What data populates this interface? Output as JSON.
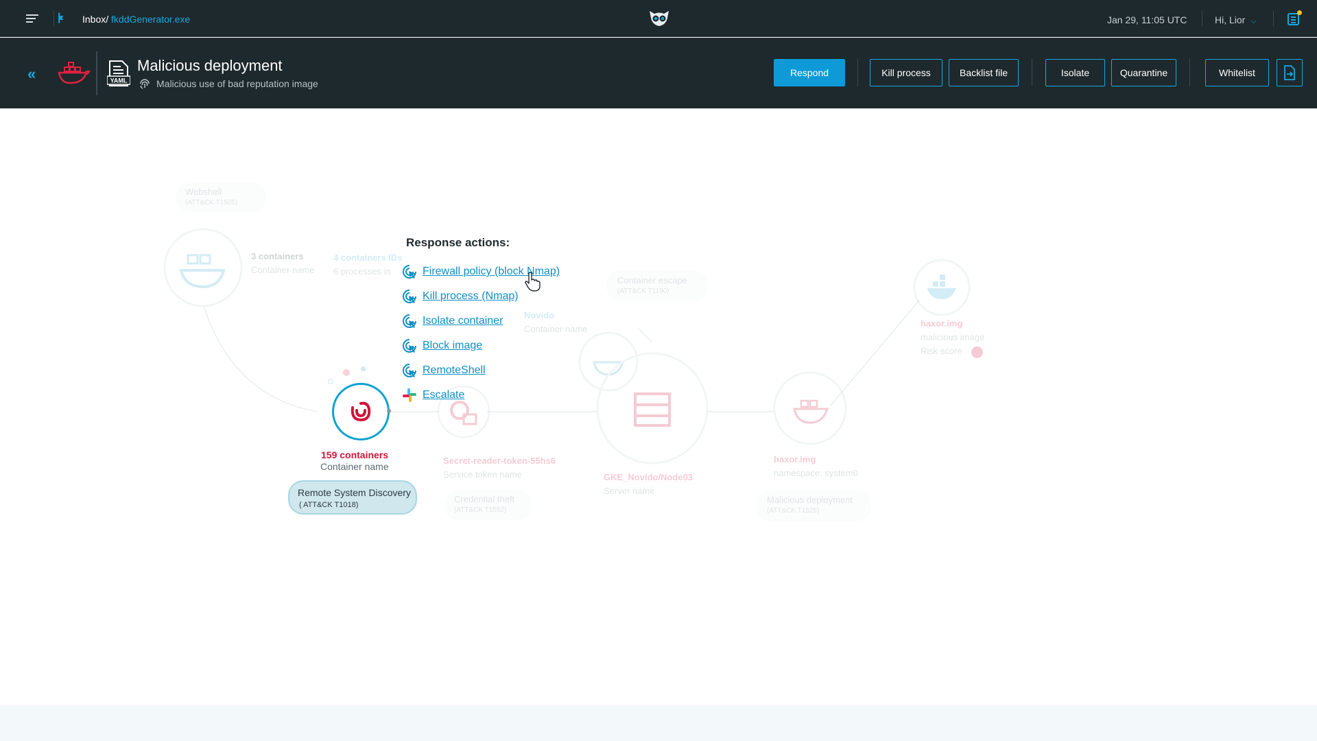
{
  "topbar": {
    "breadcrumb_root": "Inbox/",
    "breadcrumb_current": "fkddGenerator.exe",
    "datetime": "Jan 29, 11:05 UTC",
    "user_greeting": "Hi, Lior"
  },
  "header": {
    "yaml_label": "YAML",
    "title": "Malicious deployment",
    "subtitle": "Malicious use of bad reputation image",
    "buttons": {
      "respond": "Respond",
      "kill_process": "Kill  process",
      "blacklist_file": "Backlist file",
      "isolate": "Isolate",
      "quarantine": "Quarantine",
      "whitelist": "Whitelist"
    }
  },
  "graph": {
    "main_node": {
      "count": "159 containers",
      "name": "Container name",
      "technique": "Remote System Discovery",
      "technique_id": "( ATT&CK T1018)"
    },
    "ghost": {
      "webshell": "Webshell",
      "webshell_id": "(ATT&CK T1505)",
      "c1_count": "3 containers",
      "c1_name": "Container name",
      "c1_ids": "4 containers IDs",
      "c1_procs": "6 processes in",
      "novido": "Novido",
      "novido_name": "Container name",
      "escape": "Container escape",
      "escape_id": "(ATT&CK T1190)",
      "haxor_top": "haxor.img",
      "haxor_top_sub": "malicious image",
      "risk_score": "Risk score",
      "secret": "Secret-reader-token-55hs6",
      "secret_sub": "Service token name",
      "cred": "Credential theft",
      "cred_id": "(ATT&CK T1552)",
      "gke": "GKE_Novido/Node03",
      "gke_sub": "Server name",
      "haxor": "haxor.img",
      "haxor_sub": "namespace: system0",
      "malicious": "Malicious deployment",
      "malicious_id": "(ATT&CK T1525)"
    }
  },
  "response": {
    "title": "Response actions:",
    "items": [
      {
        "label": "Firewall policy (block Nmap)",
        "icon": "cursor-click-icon"
      },
      {
        "label": "Kill process (Nmap)",
        "icon": "cursor-click-icon"
      },
      {
        "label": "Isolate container",
        "icon": "cursor-click-icon"
      },
      {
        "label": "Block image",
        "icon": "cursor-click-icon"
      },
      {
        "label": "RemoteShell",
        "icon": "cursor-click-icon"
      },
      {
        "label": "Escalate",
        "icon": "slack-icon"
      }
    ]
  },
  "colors": {
    "accent": "#1aa8e0",
    "danger": "#d1143a",
    "bar_bg": "#1e292d"
  }
}
